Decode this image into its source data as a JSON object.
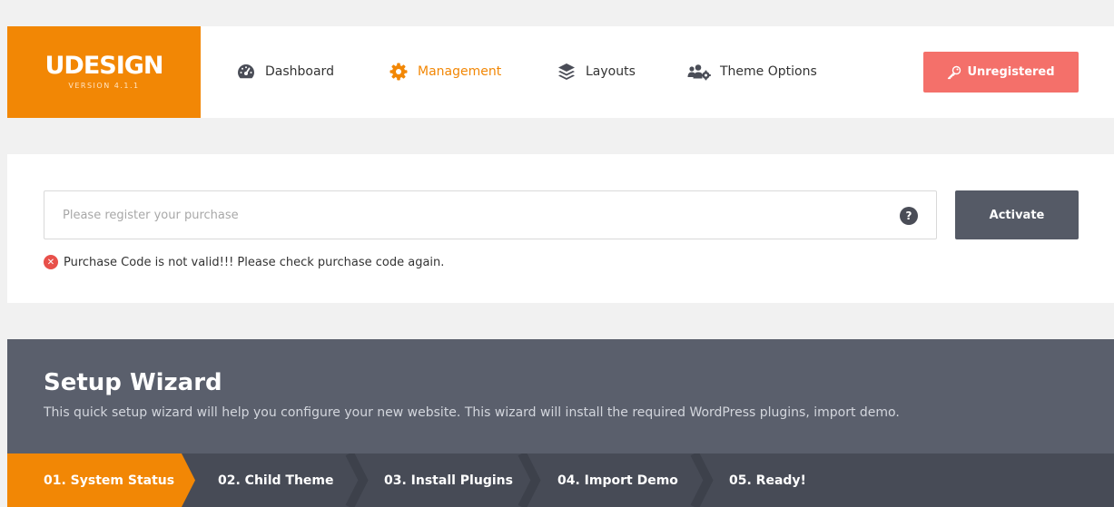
{
  "logo": {
    "title": "UDESIGN",
    "version": "VERSION 4.1.1"
  },
  "nav": [
    {
      "label": "Dashboard",
      "icon": "dashboard-gauge-icon",
      "active": false
    },
    {
      "label": "Management",
      "icon": "gear-icon",
      "active": true
    },
    {
      "label": "Layouts",
      "icon": "layers-icon",
      "active": false
    },
    {
      "label": "Theme Options",
      "icon": "users-gear-icon",
      "active": false
    }
  ],
  "header": {
    "unregistered_label": "Unregistered",
    "unregistered_icon": "key-icon"
  },
  "register": {
    "placeholder": "Please register your purchase",
    "value": "",
    "help_symbol": "?",
    "activate_label": "Activate",
    "error_text": "Purchase Code is not valid!!! Please check purchase code again.",
    "error_symbol": "✕"
  },
  "wizard": {
    "title": "Setup Wizard",
    "description": "This quick setup wizard will help you configure your new website. This wizard will install the required WordPress plugins, import demo.",
    "steps": [
      {
        "label": "01. System Status",
        "active": true
      },
      {
        "label": "02. Child Theme",
        "active": false
      },
      {
        "label": "03. Install Plugins",
        "active": false
      },
      {
        "label": "04. Import Demo",
        "active": false
      },
      {
        "label": "05. Ready!",
        "active": false
      }
    ]
  },
  "colors": {
    "accent": "#f28705",
    "unregistered": "#f4706a",
    "dark": "#555a66",
    "wizard_bg": "#5a5f6c",
    "steps_bg": "#474b56"
  }
}
